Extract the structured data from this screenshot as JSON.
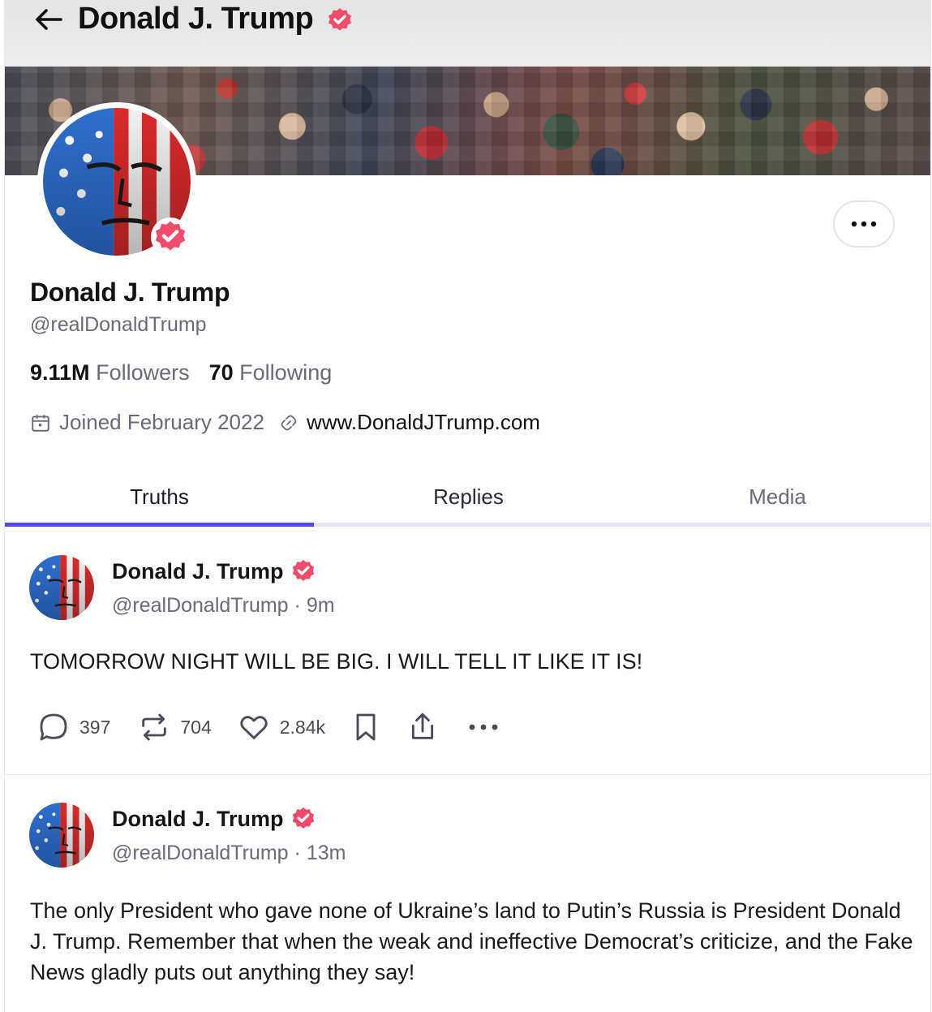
{
  "header": {
    "title": "Donald J. Trump"
  },
  "profile": {
    "name": "Donald J. Trump",
    "handle": "@realDonaldTrump",
    "followers_count": "9.11M",
    "followers_label": "Followers",
    "following_count": "70",
    "following_label": "Following",
    "joined": "Joined February 2022",
    "website": "www.DonaldJTrump.com"
  },
  "tabs": [
    {
      "label": "Truths",
      "active": true
    },
    {
      "label": "Replies",
      "active": false
    },
    {
      "label": "Media",
      "active": false
    }
  ],
  "posts": [
    {
      "author": "Donald J. Trump",
      "handle": "@realDonaldTrump",
      "time": "9m",
      "text": "TOMORROW NIGHT WILL BE BIG. I WILL TELL IT LIKE IT IS!",
      "replies": "397",
      "retruths": "704",
      "likes": "2.84k"
    },
    {
      "author": "Donald J. Trump",
      "handle": "@realDonaldTrump",
      "time": "13m",
      "text": "The only President who gave none of Ukraine’s land to Putin’s Russia is President Donald J. Trump. Remember that when the weak and ineffective Democrat’s criticize, and the Fake News gladly puts out anything they say!"
    }
  ],
  "colors": {
    "accent": "#5448ee",
    "verified_badge": "#ef4b6d",
    "muted_text": "#6a6a78"
  },
  "icons": [
    "back-arrow-icon",
    "verified-badge-icon",
    "more-icon",
    "calendar-icon",
    "link-icon",
    "reply-icon",
    "retruth-icon",
    "like-icon",
    "bookmark-icon",
    "share-icon"
  ]
}
